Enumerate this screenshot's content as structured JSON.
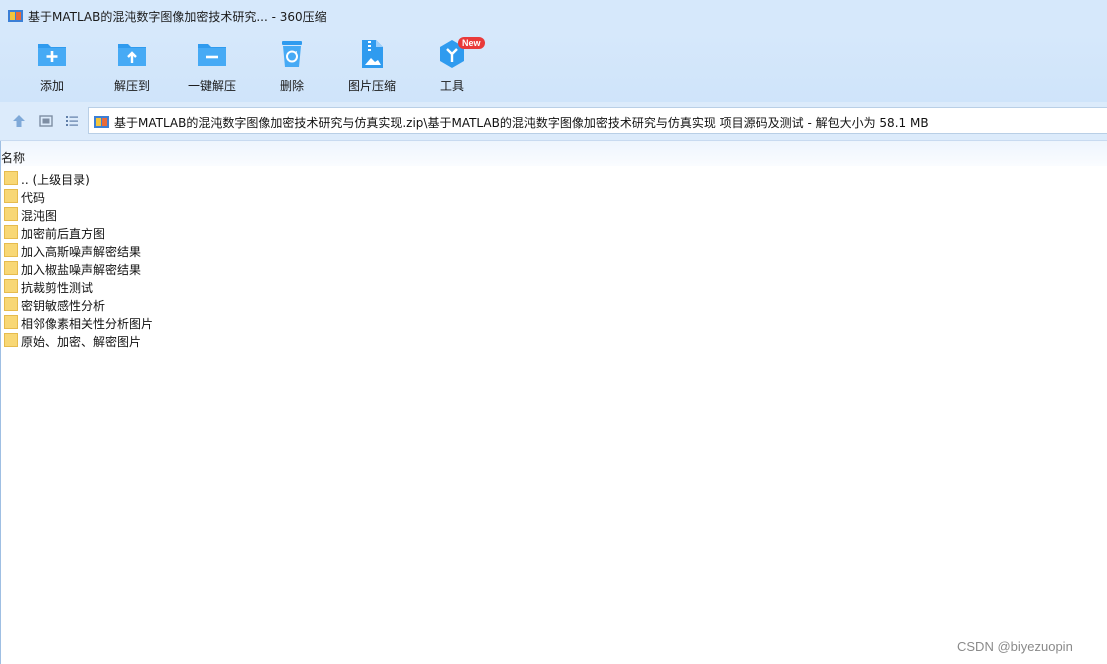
{
  "window": {
    "title": "基于MATLAB的混沌数字图像加密技术研究... - 360压缩"
  },
  "toolbar": {
    "items": [
      {
        "label": "添加",
        "icon": "add-folder-icon"
      },
      {
        "label": "解压到",
        "icon": "extract-to-icon"
      },
      {
        "label": "一键解压",
        "icon": "one-click-extract-icon"
      },
      {
        "label": "删除",
        "icon": "recycle-bin-icon"
      },
      {
        "label": "图片压缩",
        "icon": "image-compress-icon"
      },
      {
        "label": "工具",
        "icon": "tools-icon",
        "badge": "New"
      }
    ]
  },
  "navbar": {
    "path": "基于MATLAB的混沌数字图像加密技术研究与仿真实现.zip\\基于MATLAB的混沌数字图像加密技术研究与仿真实现 项目源码及测试 - 解包大小为 58.1 MB"
  },
  "list": {
    "column_name": "名称",
    "rows": [
      ".. (上级目录)",
      "代码",
      "混沌图",
      "加密前后直方图",
      "加入高斯噪声解密结果",
      "加入椒盐噪声解密结果",
      "抗裁剪性测试",
      "密钥敏感性分析",
      "相邻像素相关性分析图片",
      "原始、加密、解密图片"
    ]
  },
  "watermark": "CSDN @biyezuopin",
  "colors": {
    "accent": "#2f9bef",
    "toolbar_bg": "#d6e8fb",
    "folder": "#f8d775",
    "badge": "#e93a3a"
  }
}
